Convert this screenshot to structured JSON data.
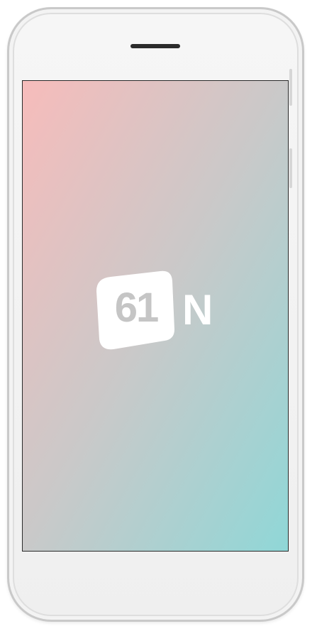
{
  "device": {
    "frame_color": "#efefef",
    "speaker_color": "#2b2b2b"
  },
  "screen": {
    "gradient_top_left": "#f7bcbb",
    "gradient_bottom_right": "#8fd7d7"
  },
  "logo": {
    "badge_text": "61",
    "letter": "N",
    "badge_color": "#ffffff",
    "badge_text_color": "#c5c5c5",
    "letter_color": "#ffffff"
  }
}
